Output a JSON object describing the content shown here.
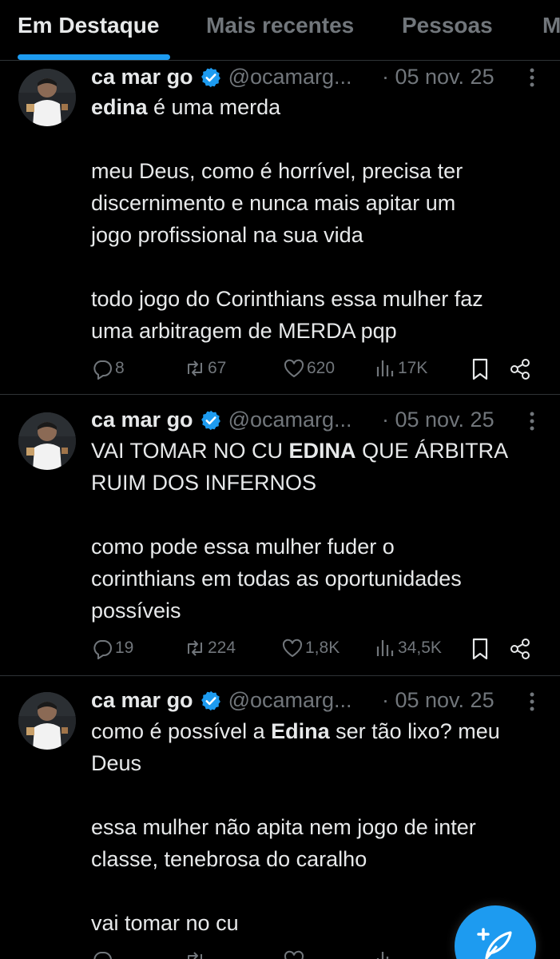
{
  "tabs": [
    {
      "label": "Em Destaque",
      "active": true
    },
    {
      "label": "Mais recentes",
      "active": false
    },
    {
      "label": "Pessoas",
      "active": false
    },
    {
      "label": "M",
      "active": false
    }
  ],
  "colors": {
    "accent": "#1d9bf0",
    "muted": "#71767b",
    "text": "#e7e9ea",
    "background": "#000000",
    "divider": "#2f3336"
  },
  "tweets": [
    {
      "name": "ca mar go",
      "handle": "@ocamarg...",
      "date": "· 05 nov. 25",
      "lines": [
        [
          {
            "t": "edina",
            "bold": true
          },
          {
            "t": " é uma merda",
            "bold": false
          }
        ],
        [],
        [
          {
            "t": "meu Deus, como é horrível, precisa ter",
            "bold": false
          }
        ],
        [
          {
            "t": "discernimento e nunca mais apitar um",
            "bold": false
          }
        ],
        [
          {
            "t": "jogo profissional na sua vida",
            "bold": false
          }
        ],
        [],
        [
          {
            "t": "todo jogo do Corinthians essa mulher faz",
            "bold": false
          }
        ],
        [
          {
            "t": "uma arbitragem de MERDA pqp",
            "bold": false
          }
        ]
      ],
      "replies": "8",
      "retweets": "67",
      "likes": "620",
      "views": "17K"
    },
    {
      "name": "ca mar go",
      "handle": "@ocamarg...",
      "date": "· 05 nov. 25",
      "lines": [
        [
          {
            "t": "VAI TOMAR NO CU ",
            "bold": false
          },
          {
            "t": "EDINA",
            "bold": true
          },
          {
            "t": " QUE ÁRBITRA",
            "bold": false
          }
        ],
        [
          {
            "t": "RUIM DOS INFERNOS",
            "bold": false
          }
        ],
        [],
        [
          {
            "t": "como pode essa mulher fuder o",
            "bold": false
          }
        ],
        [
          {
            "t": "corinthians em todas as oportunidades",
            "bold": false
          }
        ],
        [
          {
            "t": "possíveis",
            "bold": false
          }
        ]
      ],
      "replies": "19",
      "retweets": "224",
      "likes": "1,8K",
      "views": "34,5K"
    },
    {
      "name": "ca mar go",
      "handle": "@ocamarg...",
      "date": "· 05 nov. 25",
      "lines": [
        [
          {
            "t": "como é possível a ",
            "bold": false
          },
          {
            "t": "Edina",
            "bold": true
          },
          {
            "t": " ser tão lixo? meu",
            "bold": false
          }
        ],
        [
          {
            "t": "Deus",
            "bold": false
          }
        ],
        [],
        [
          {
            "t": "essa mulher não apita nem jogo de inter",
            "bold": false
          }
        ],
        [
          {
            "t": "classe, tenebrosa do caralho",
            "bold": false
          }
        ],
        [],
        [
          {
            "t": "vai tomar no cu",
            "bold": false
          }
        ]
      ],
      "replies": "",
      "retweets": "",
      "likes": "",
      "views": ""
    }
  ],
  "icons": [
    "verified-badge-icon",
    "more-options-icon",
    "reply-icon",
    "retweet-icon",
    "like-icon",
    "views-icon",
    "bookmark-icon",
    "share-icon",
    "compose-icon"
  ]
}
